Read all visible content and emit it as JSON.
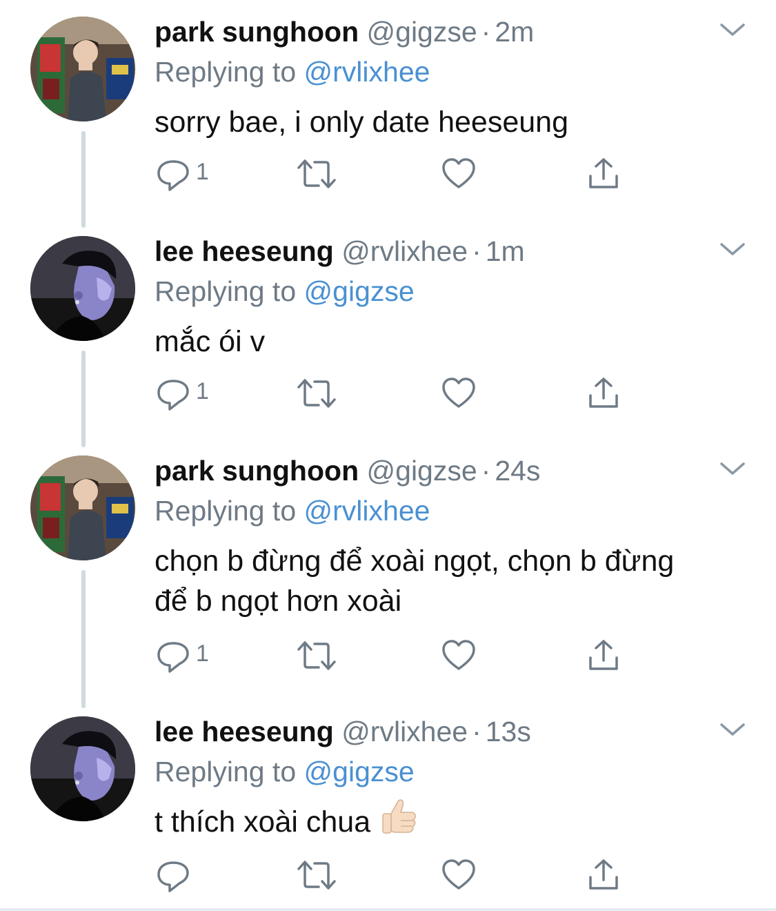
{
  "colors": {
    "name": "#111111",
    "muted": "#6e7a85",
    "link": "#4a90d2",
    "thread_line": "#cfd9de"
  },
  "tweets": [
    {
      "name": "park sunghoon",
      "handle": "@gigzse",
      "separator": "·",
      "time": "2m",
      "reply_prefix": "Replying to",
      "reply_to": "@rvlixhee",
      "text_lines": [
        "sorry bae, i only date heeseung"
      ],
      "reply_count": "1",
      "avatar": "avatar-arcade-photo"
    },
    {
      "name": "lee heeseung",
      "handle": "@rvlixhee",
      "separator": "·",
      "time": "1m",
      "reply_prefix": "Replying to",
      "reply_to": "@gigzse",
      "text_lines": [
        "mắc ói v"
      ],
      "reply_count": "1",
      "avatar": "avatar-dark-portrait"
    },
    {
      "name": "park sunghoon",
      "handle": "@gigzse",
      "separator": "·",
      "time": "24s",
      "reply_prefix": "Replying to",
      "reply_to": "@rvlixhee",
      "text_lines": [
        "chọn b đừng để xoài ngọt, chọn b đừng",
        "để b ngọt hơn xoài"
      ],
      "reply_count": "1",
      "avatar": "avatar-arcade-photo"
    },
    {
      "name": "lee heeseung",
      "handle": "@rvlixhee",
      "separator": "·",
      "time": "13s",
      "reply_prefix": "Replying to",
      "reply_to": "@gigzse",
      "text_lines": [
        "t thích xoài chua"
      ],
      "text_emoji": "thumbs-up",
      "reply_count": "",
      "avatar": "avatar-dark-portrait"
    }
  ]
}
